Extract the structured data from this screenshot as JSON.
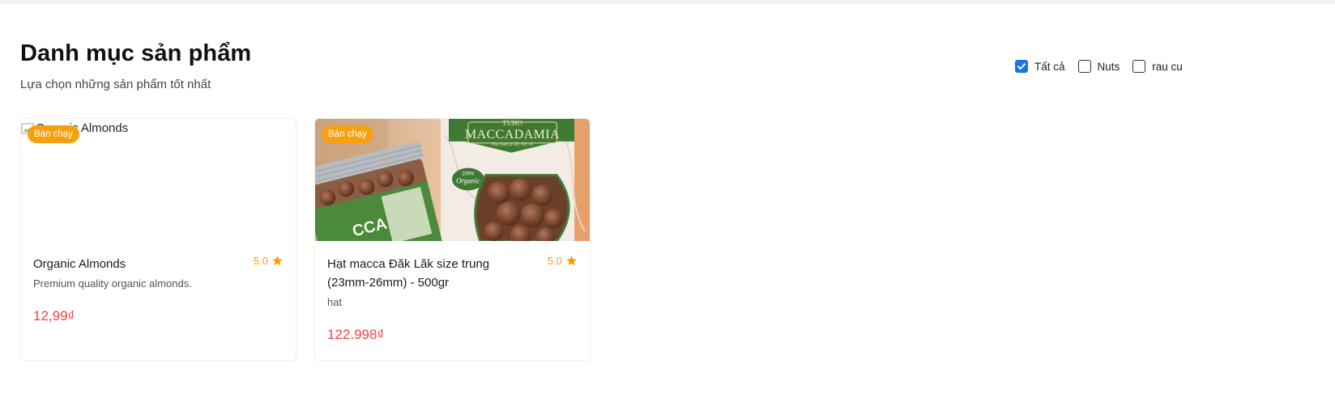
{
  "header": {
    "title": "Danh mục sản phẩm",
    "subtitle": "Lựa chọn những sản phẩm tốt nhất"
  },
  "filters": [
    {
      "label": "Tất cả",
      "checked": true
    },
    {
      "label": "Nuts",
      "checked": false
    },
    {
      "label": "rau cu",
      "checked": false
    }
  ],
  "products": [
    {
      "name": "Organic Almonds",
      "image_alt": "Organic Almonds",
      "badge": "Bán chạy",
      "rating": "5.0",
      "description": "Premium quality organic almonds.",
      "price": "12,99₫"
    },
    {
      "name": "Hạt macca Đăk Lăk size trung (23mm-26mm) - 500gr",
      "badge": "Bán chạy",
      "rating": "5.0",
      "description": "hat",
      "price": "122.998₫",
      "image_text": {
        "brand": "TUHO",
        "title": "MACCADAMIA",
        "tagline": "Hạt macca sấy nứt vỏ",
        "stamp_top": "100%",
        "stamp": "Organic",
        "jar_text": "CCA"
      }
    }
  ],
  "colors": {
    "badge": "#f5a10f",
    "price": "#ef4444",
    "rating": "#f59e0b",
    "checkbox_checked": "#1a73e8"
  }
}
